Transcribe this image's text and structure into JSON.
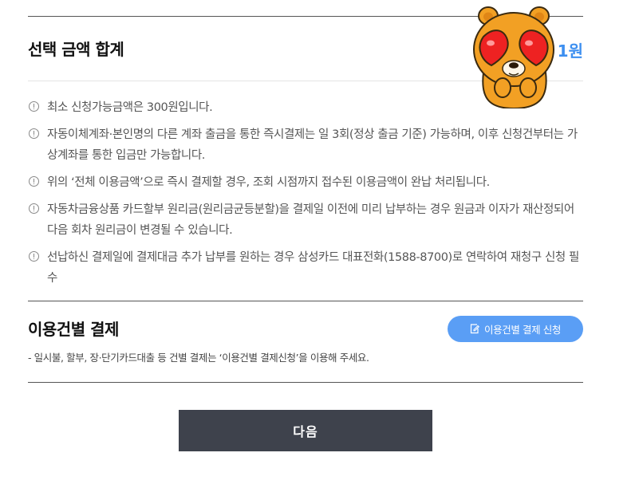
{
  "summary": {
    "title": "선택 금액 합계",
    "amount": "1원"
  },
  "notes": [
    {
      "text": "최소 신청가능금액은 300원입니다."
    },
    {
      "text": "자동이체계좌·본인명의 다른 계좌 출금을 통한 즉시결제는 일 3회(정상 출금 기준) 가능하며, 이후 신청건부터는 가상계좌를 통한 입금만 가능합니다."
    },
    {
      "text": "위의 ‘전체 이용금액’으로 즉시 결제할 경우, 조회 시점까지 접수된 이용금액이 완납 처리됩니다."
    },
    {
      "text": "자동차금융상품 카드할부 원리금(원리금균등분할)을 결제일 이전에 미리 납부하는 경우 원금과 이자가 재산정되어 다음 회차 원리금이 변경될 수 있습니다."
    },
    {
      "text": "선납하신 결제일에 결제대금 추가 납부를 원하는 경우 삼성카드 대표전화(1588-8700)로 연락하여 재청구 신청 필수"
    }
  ],
  "per_item": {
    "title": "이용건별 결제",
    "button_label": "이용건별 결제 신청",
    "button_icon": "edit-icon",
    "note": "-  일시불, 할부, 장·단기카드대출 등 건별 결제는 ‘이용건별 결제신청’을 이용해 주세요."
  },
  "footer": {
    "next_label": "다음"
  },
  "colors": {
    "accent": "#3d8ff0",
    "button_blue": "#5a9ef5",
    "button_dark": "#3e424c"
  },
  "mascot": {
    "icon": "heart-eyes-bear-sticker"
  }
}
